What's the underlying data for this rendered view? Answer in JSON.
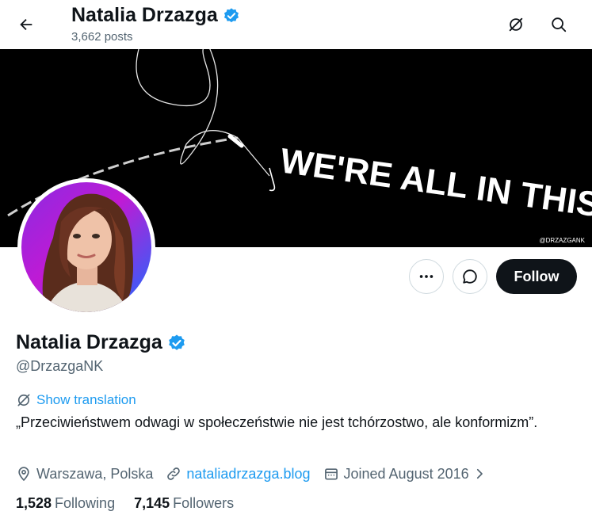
{
  "header": {
    "name": "Natalia Drzazga",
    "post_count": "3,662 posts"
  },
  "banner": {
    "slogan": "WE'RE ALL IN THIS PSYOP TOGETHER",
    "watermark": "@DRZAZGANK"
  },
  "actions": {
    "follow_label": "Follow"
  },
  "profile": {
    "name": "Natalia Drzazga",
    "handle": "@DrzazgaNK",
    "show_translation_label": "Show translation",
    "bio": "„Przeciwieństwem odwagi w społeczeństwie nie jest tchórzostwo, ale konformizm”.",
    "location": "Warszawa, Polska",
    "website": "nataliadrzazga.blog",
    "joined": "Joined August 2016"
  },
  "stats": {
    "following_count": "1,528",
    "following_label": "Following",
    "followers_count": "7,145",
    "followers_label": "Followers"
  },
  "colors": {
    "accent": "#1d9bf0",
    "text": "#0f1419",
    "secondary": "#536471",
    "border": "#cfd9de"
  }
}
